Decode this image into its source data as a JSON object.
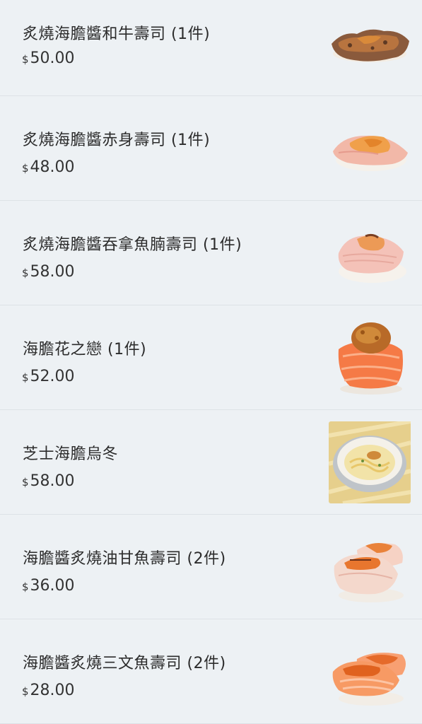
{
  "items": [
    {
      "name": "炙燒海膽醬和牛壽司 (1件)",
      "currency": "$",
      "price": "50.00",
      "image": "wagyu-sushi-photo"
    },
    {
      "name": "炙燒海膽醬赤身壽司 (1件)",
      "currency": "$",
      "price": "48.00",
      "image": "akami-sushi-photo"
    },
    {
      "name": "炙燒海膽醬吞拿魚腩壽司 (1件)",
      "currency": "$",
      "price": "58.00",
      "image": "tuna-belly-sushi-photo"
    },
    {
      "name": "海膽花之戀 (1件)",
      "currency": "$",
      "price": "52.00",
      "image": "uni-salmon-flower-photo"
    },
    {
      "name": "芝士海膽烏冬",
      "currency": "$",
      "price": "58.00",
      "image": "cheese-uni-udon-photo"
    },
    {
      "name": "海膽醬炙燒油甘魚壽司 (2件)",
      "currency": "$",
      "price": "36.00",
      "image": "yellowtail-sushi-photo"
    },
    {
      "name": "海膽醬炙燒三文魚壽司 (2件)",
      "currency": "$",
      "price": "28.00",
      "image": "salmon-sushi-photo"
    }
  ]
}
